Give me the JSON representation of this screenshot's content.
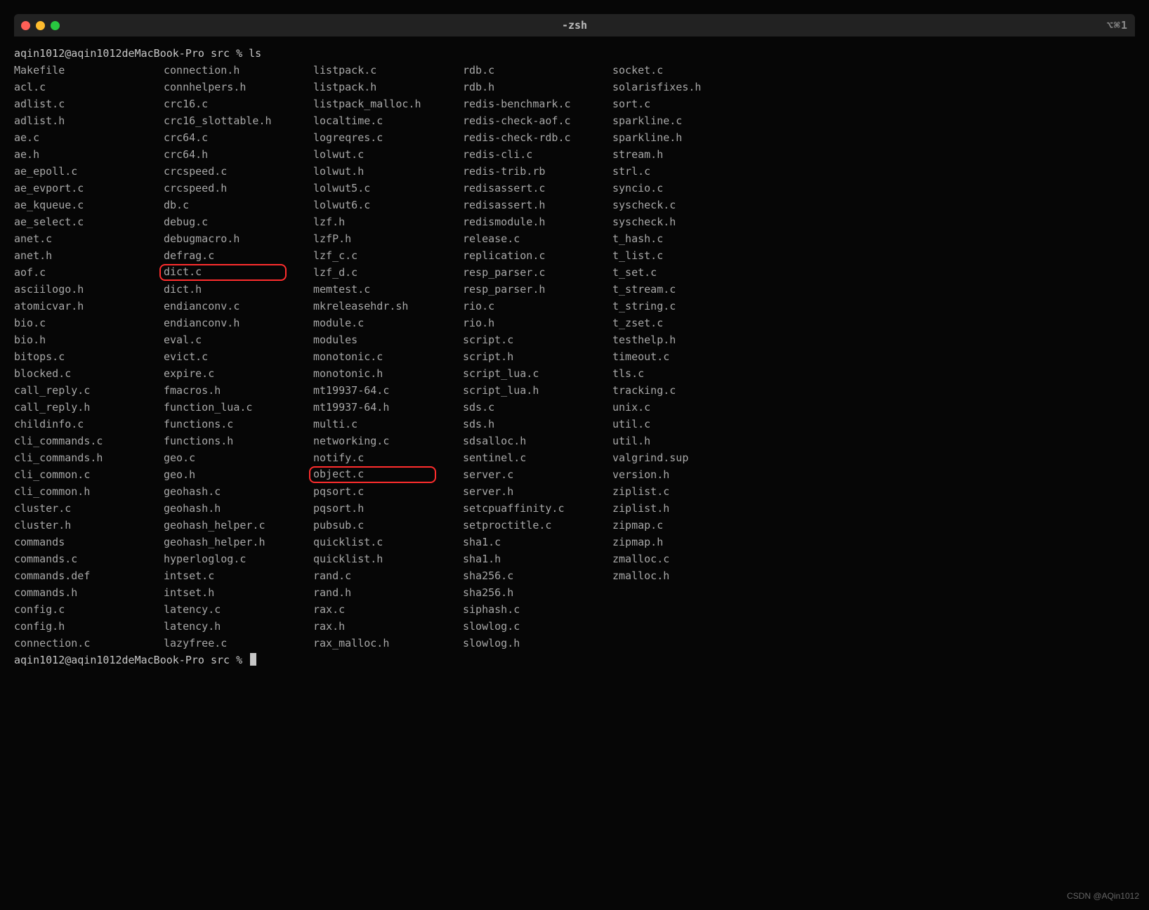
{
  "window": {
    "title": "-zsh",
    "shortcut": "⌥⌘1"
  },
  "prompt": {
    "user_host": "aqin1012@aqin1012deMacBook-Pro",
    "cwd": "src",
    "symbol": "%",
    "command": "ls"
  },
  "highlighted_files": [
    "dict.c",
    "object.c"
  ],
  "listing": {
    "col1": [
      "Makefile",
      "acl.c",
      "adlist.c",
      "adlist.h",
      "ae.c",
      "ae.h",
      "ae_epoll.c",
      "ae_evport.c",
      "ae_kqueue.c",
      "ae_select.c",
      "anet.c",
      "anet.h",
      "aof.c",
      "asciilogo.h",
      "atomicvar.h",
      "bio.c",
      "bio.h",
      "bitops.c",
      "blocked.c",
      "call_reply.c",
      "call_reply.h",
      "childinfo.c",
      "cli_commands.c",
      "cli_commands.h",
      "cli_common.c",
      "cli_common.h",
      "cluster.c",
      "cluster.h",
      "commands",
      "commands.c",
      "commands.def",
      "commands.h",
      "config.c",
      "config.h",
      "connection.c"
    ],
    "col2": [
      "connection.h",
      "connhelpers.h",
      "crc16.c",
      "crc16_slottable.h",
      "crc64.c",
      "crc64.h",
      "crcspeed.c",
      "crcspeed.h",
      "db.c",
      "debug.c",
      "debugmacro.h",
      "defrag.c",
      "dict.c",
      "dict.h",
      "endianconv.c",
      "endianconv.h",
      "eval.c",
      "evict.c",
      "expire.c",
      "fmacros.h",
      "function_lua.c",
      "functions.c",
      "functions.h",
      "geo.c",
      "geo.h",
      "geohash.c",
      "geohash.h",
      "geohash_helper.c",
      "geohash_helper.h",
      "hyperloglog.c",
      "intset.c",
      "intset.h",
      "latency.c",
      "latency.h",
      "lazyfree.c"
    ],
    "col3": [
      "listpack.c",
      "listpack.h",
      "listpack_malloc.h",
      "localtime.c",
      "logreqres.c",
      "lolwut.c",
      "lolwut.h",
      "lolwut5.c",
      "lolwut6.c",
      "lzf.h",
      "lzfP.h",
      "lzf_c.c",
      "lzf_d.c",
      "memtest.c",
      "mkreleasehdr.sh",
      "module.c",
      "modules",
      "monotonic.c",
      "monotonic.h",
      "mt19937-64.c",
      "mt19937-64.h",
      "multi.c",
      "networking.c",
      "notify.c",
      "object.c",
      "pqsort.c",
      "pqsort.h",
      "pubsub.c",
      "quicklist.c",
      "quicklist.h",
      "rand.c",
      "rand.h",
      "rax.c",
      "rax.h",
      "rax_malloc.h"
    ],
    "col4": [
      "rdb.c",
      "rdb.h",
      "redis-benchmark.c",
      "redis-check-aof.c",
      "redis-check-rdb.c",
      "redis-cli.c",
      "redis-trib.rb",
      "redisassert.c",
      "redisassert.h",
      "redismodule.h",
      "release.c",
      "replication.c",
      "resp_parser.c",
      "resp_parser.h",
      "rio.c",
      "rio.h",
      "script.c",
      "script.h",
      "script_lua.c",
      "script_lua.h",
      "sds.c",
      "sds.h",
      "sdsalloc.h",
      "sentinel.c",
      "server.c",
      "server.h",
      "setcpuaffinity.c",
      "setproctitle.c",
      "sha1.c",
      "sha1.h",
      "sha256.c",
      "sha256.h",
      "siphash.c",
      "slowlog.c",
      "slowlog.h"
    ],
    "col5": [
      "socket.c",
      "solarisfixes.h",
      "sort.c",
      "sparkline.c",
      "sparkline.h",
      "stream.h",
      "strl.c",
      "syncio.c",
      "syscheck.c",
      "syscheck.h",
      "t_hash.c",
      "t_list.c",
      "t_set.c",
      "t_stream.c",
      "t_string.c",
      "t_zset.c",
      "testhelp.h",
      "timeout.c",
      "tls.c",
      "tracking.c",
      "unix.c",
      "util.c",
      "util.h",
      "valgrind.sup",
      "version.h",
      "ziplist.c",
      "ziplist.h",
      "zipmap.c",
      "zipmap.h",
      "zmalloc.c",
      "zmalloc.h"
    ]
  },
  "watermark": "CSDN @AQin1012"
}
